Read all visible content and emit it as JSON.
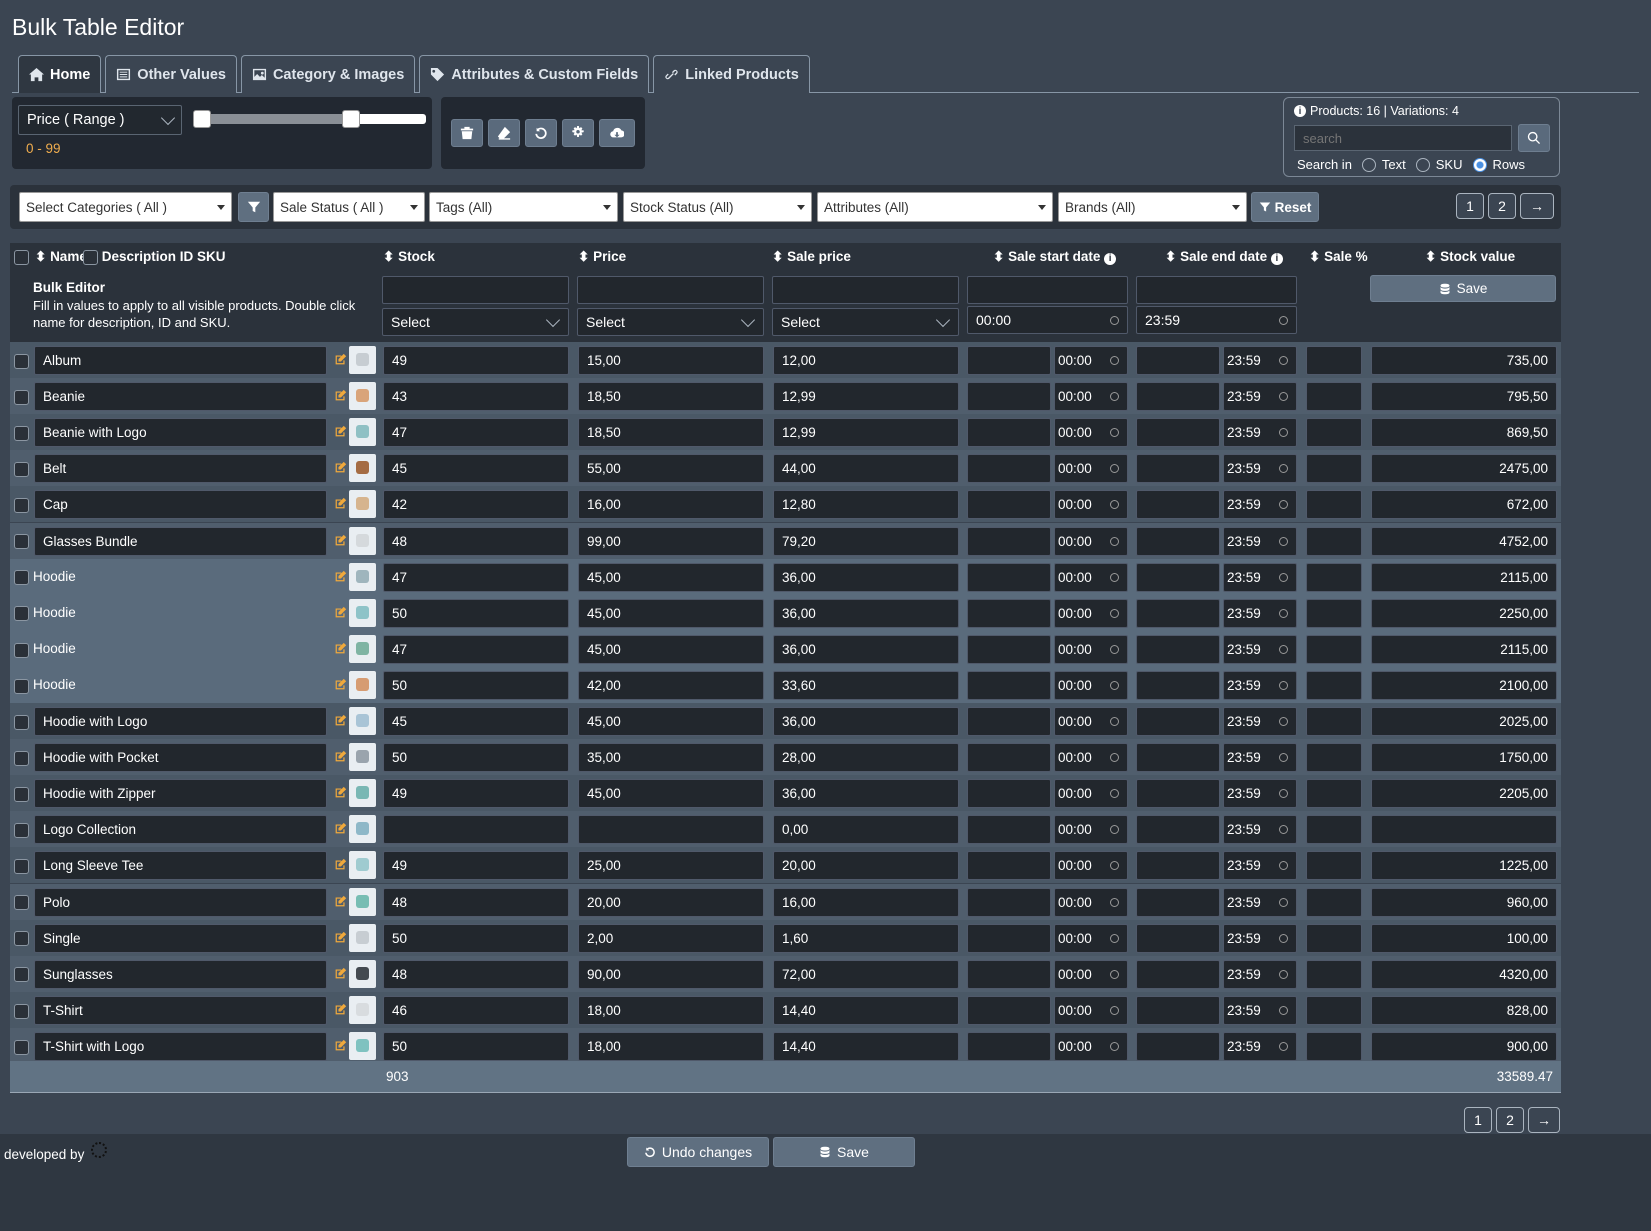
{
  "app": {
    "title": "Bulk Table Editor"
  },
  "tabs": [
    {
      "label": "Home",
      "icon": "home-icon"
    },
    {
      "label": "Other Values",
      "icon": "list-icon"
    },
    {
      "label": "Category & Images",
      "icon": "image-icon"
    },
    {
      "label": "Attributes & Custom Fields",
      "icon": "tag-icon"
    },
    {
      "label": "Linked Products",
      "icon": "link-icon"
    }
  ],
  "price_filter": {
    "label": "Price ( Range )",
    "range_text": "0 - 99",
    "range_text_color": "#f0ad4e",
    "min": 0,
    "max": 99,
    "upper_handle_fraction": 0.62
  },
  "toolbar": {
    "icons": [
      "trash-icon",
      "eraser-icon",
      "undo-icon",
      "gear-icon",
      "cloud-download-icon"
    ]
  },
  "search": {
    "info": "Products: 16 | Variations: 4",
    "placeholder": "search",
    "search_in_label": "Search in",
    "options": [
      "Text",
      "SKU",
      "Rows"
    ],
    "selected": "Rows"
  },
  "filters": {
    "categories": "Select Categories ( All )",
    "sale_status": "Sale Status ( All )",
    "tags": "Tags (All)",
    "stock_status": "Stock Status (All)",
    "attributes": "Attributes (All)",
    "brands": "Brands (All)",
    "reset_label": "Reset"
  },
  "pagination": {
    "pages": [
      "1",
      "2"
    ],
    "next": "→"
  },
  "columns": {
    "name": "Name",
    "desc": "Description ID SKU",
    "stock": "Stock",
    "price": "Price",
    "sale_price": "Sale price",
    "sale_start": "Sale start date",
    "sale_end": "Sale end date",
    "sale_pct": "Sale %",
    "stock_value": "Stock value"
  },
  "bulk_editor": {
    "title": "Bulk Editor",
    "description": "Fill in values to apply to all visible products. Double click name for description, ID and SKU.",
    "select_label": "Select",
    "start_time": "00:00",
    "end_time": "23:59",
    "save_label": "Save"
  },
  "rows": [
    {
      "name": "Album",
      "stock": "49",
      "price": "15,00",
      "sale": "12,00",
      "start": "00:00",
      "end": "23:59",
      "value": "735,00",
      "variation": false,
      "thumb": "#c7cdd2"
    },
    {
      "name": "Beanie",
      "stock": "43",
      "price": "18,50",
      "sale": "12,99",
      "start": "00:00",
      "end": "23:59",
      "value": "795,50",
      "variation": false,
      "thumb": "#d9a47a"
    },
    {
      "name": "Beanie with Logo",
      "stock": "47",
      "price": "18,50",
      "sale": "12,99",
      "start": "00:00",
      "end": "23:59",
      "value": "869,50",
      "variation": false,
      "thumb": "#8fc0c4"
    },
    {
      "name": "Belt",
      "stock": "45",
      "price": "55,00",
      "sale": "44,00",
      "start": "00:00",
      "end": "23:59",
      "value": "2475,00",
      "variation": false,
      "thumb": "#a56c43"
    },
    {
      "name": "Cap",
      "stock": "42",
      "price": "16,00",
      "sale": "12,80",
      "start": "00:00",
      "end": "23:59",
      "value": "672,00",
      "variation": false,
      "thumb": "#d6b48e"
    },
    {
      "name": "Glasses Bundle",
      "stock": "48",
      "price": "99,00",
      "sale": "79,20",
      "start": "00:00",
      "end": "23:59",
      "value": "4752,00",
      "variation": false,
      "thumb": "#d5d9dc"
    },
    {
      "name": "Hoodie",
      "stock": "47",
      "price": "45,00",
      "sale": "36,00",
      "start": "00:00",
      "end": "23:59",
      "value": "2115,00",
      "variation": true,
      "thumb": "#9fb5bd"
    },
    {
      "name": "Hoodie",
      "stock": "50",
      "price": "45,00",
      "sale": "36,00",
      "start": "00:00",
      "end": "23:59",
      "value": "2250,00",
      "variation": true,
      "thumb": "#8ec3c8"
    },
    {
      "name": "Hoodie",
      "stock": "47",
      "price": "45,00",
      "sale": "36,00",
      "start": "00:00",
      "end": "23:59",
      "value": "2115,00",
      "variation": true,
      "thumb": "#7fb4a3"
    },
    {
      "name": "Hoodie",
      "stock": "50",
      "price": "42,00",
      "sale": "33,60",
      "start": "00:00",
      "end": "23:59",
      "value": "2100,00",
      "variation": true,
      "thumb": "#d69c72"
    },
    {
      "name": "Hoodie with Logo",
      "stock": "45",
      "price": "45,00",
      "sale": "36,00",
      "start": "00:00",
      "end": "23:59",
      "value": "2025,00",
      "variation": false,
      "thumb": "#a9c4d6"
    },
    {
      "name": "Hoodie with Pocket",
      "stock": "50",
      "price": "35,00",
      "sale": "28,00",
      "start": "00:00",
      "end": "23:59",
      "value": "1750,00",
      "variation": false,
      "thumb": "#9aa4ad"
    },
    {
      "name": "Hoodie with Zipper",
      "stock": "49",
      "price": "45,00",
      "sale": "36,00",
      "start": "00:00",
      "end": "23:59",
      "value": "2205,00",
      "variation": false,
      "thumb": "#79b7b4"
    },
    {
      "name": "Logo Collection",
      "stock": "",
      "price": "",
      "sale": "0,00",
      "start": "00:00",
      "end": "23:59",
      "value": "",
      "variation": false,
      "thumb": "#8eb8c8"
    },
    {
      "name": "Long Sleeve Tee",
      "stock": "49",
      "price": "25,00",
      "sale": "20,00",
      "start": "00:00",
      "end": "23:59",
      "value": "1225,00",
      "variation": false,
      "thumb": "#9fcbd0"
    },
    {
      "name": "Polo",
      "stock": "48",
      "price": "20,00",
      "sale": "16,00",
      "start": "00:00",
      "end": "23:59",
      "value": "960,00",
      "variation": false,
      "thumb": "#77bdb3"
    },
    {
      "name": "Single",
      "stock": "50",
      "price": "2,00",
      "sale": "1,60",
      "start": "00:00",
      "end": "23:59",
      "value": "100,00",
      "variation": false,
      "thumb": "#c7cdd2"
    },
    {
      "name": "Sunglasses",
      "stock": "48",
      "price": "90,00",
      "sale": "72,00",
      "start": "00:00",
      "end": "23:59",
      "value": "4320,00",
      "variation": false,
      "thumb": "#444a50"
    },
    {
      "name": "T-Shirt",
      "stock": "46",
      "price": "18,00",
      "sale": "14,40",
      "start": "00:00",
      "end": "23:59",
      "value": "828,00",
      "variation": false,
      "thumb": "#d8dcdf"
    },
    {
      "name": "T-Shirt with Logo",
      "stock": "50",
      "price": "18,00",
      "sale": "14,40",
      "start": "00:00",
      "end": "23:59",
      "value": "900,00",
      "variation": false,
      "thumb": "#7fc2c0"
    }
  ],
  "totals": {
    "stock": "903",
    "value": "33589.47"
  },
  "footer": {
    "developed_by": "developed by",
    "undo_label": "Undo changes",
    "save_label": "Save"
  },
  "colors": {
    "edit_icon": "#f0a93c",
    "variation_row": "#5a6b7c",
    "row_bg": "#4a5866"
  }
}
